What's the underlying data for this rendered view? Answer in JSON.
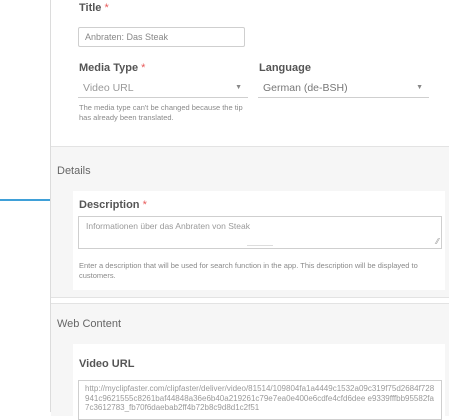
{
  "title_field": {
    "label": "Title",
    "required_mark": "*",
    "value": "Anbraten: Das Steak"
  },
  "media_type": {
    "label": "Media Type",
    "required_mark": "*",
    "value": "Video URL",
    "help": "The media type can't be changed because the tip has already been translated."
  },
  "language": {
    "label": "Language",
    "value": "German (de-BSH)"
  },
  "details": {
    "section_title": "Details",
    "description": {
      "label": "Description",
      "required_mark": "*",
      "value": "Informationen über das Anbraten von Steak",
      "help": "Enter a description that will be used for search function in the app. This description will be displayed to customers."
    }
  },
  "web_content": {
    "section_title": "Web Content",
    "video_url": {
      "label": "Video URL",
      "value": "http://myclipfaster.com/clipfaster/deliver/video/81514/109804fa1a4449c1532a09c319f75d2684f728941c9621555c8261baf44848a36e6b40a219261c79e7ea0e400e6cdfe4cfd6dee e9339fffbb95582fa7c3612783_fb70f6daebab2ff4b72b8c9d8d1c2f51"
    }
  },
  "colors": {
    "accent": "#3fa0d8",
    "required": "#e85a5a"
  },
  "icons": {
    "dropdown": "chevron-down-icon",
    "resize": "resize-handle-icon"
  }
}
